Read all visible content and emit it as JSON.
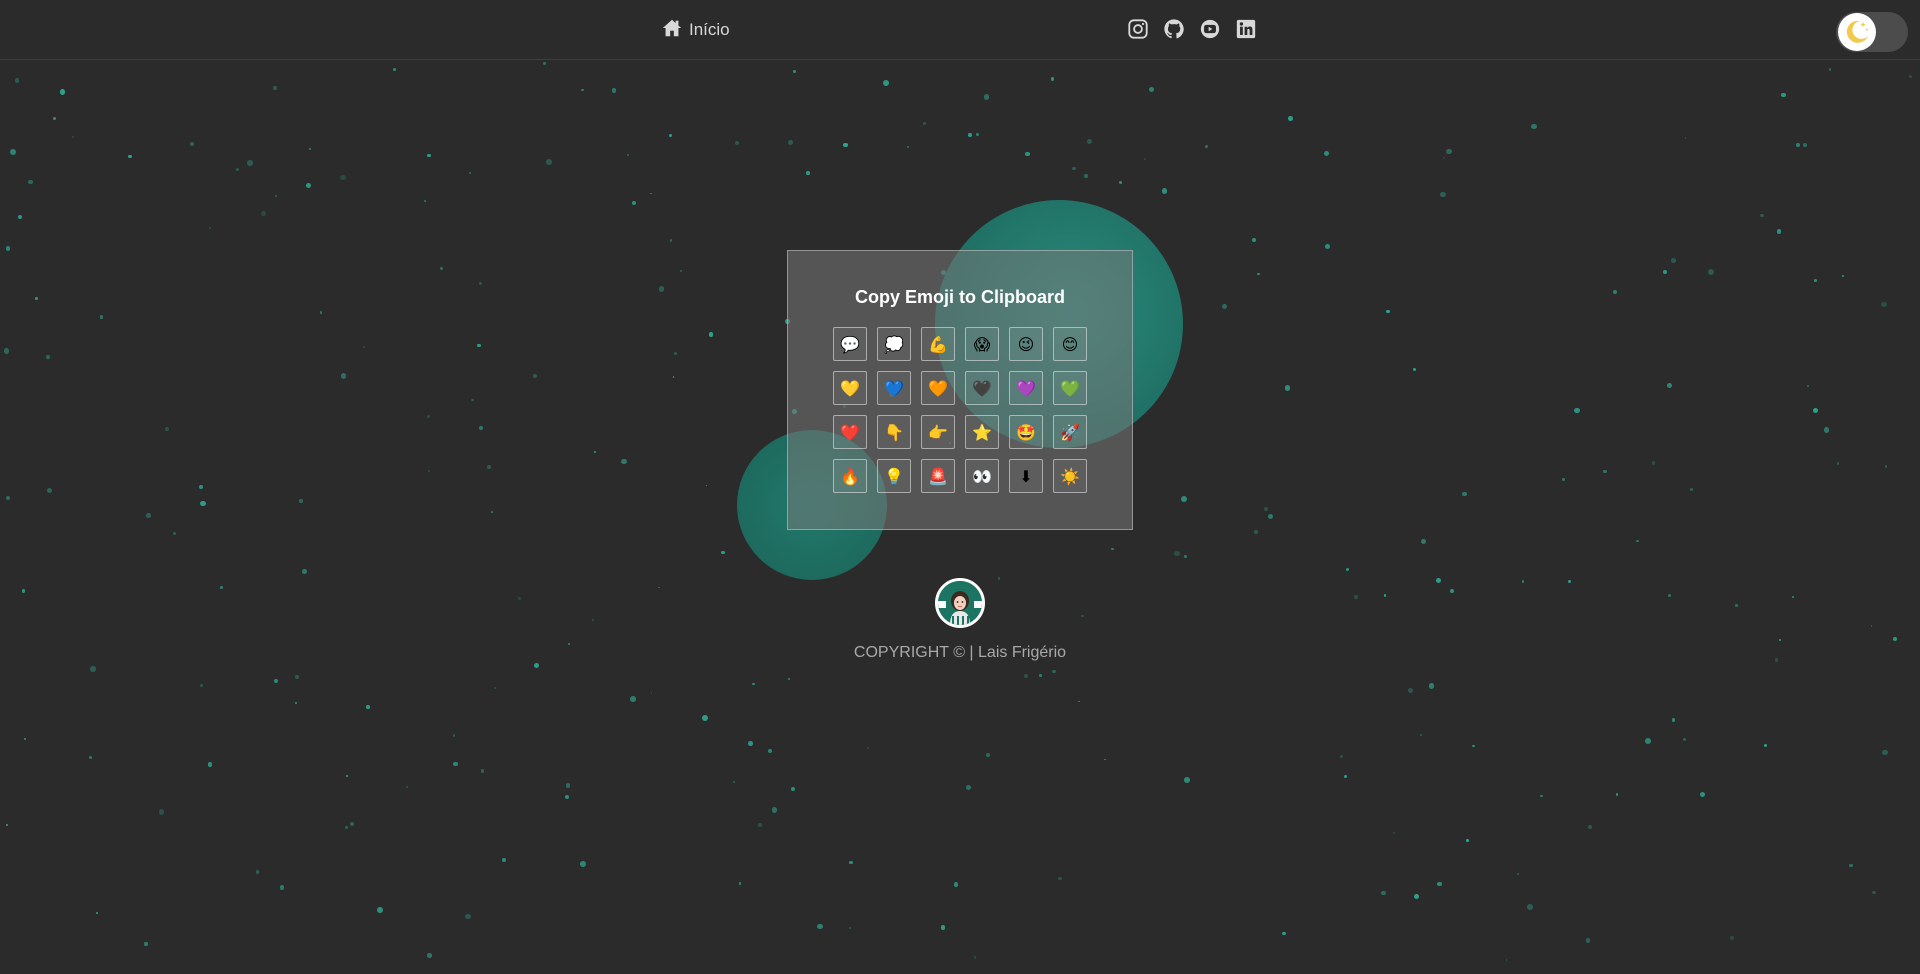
{
  "header": {
    "home_label": "Início",
    "social_links": [
      {
        "icon": "instagram-icon"
      },
      {
        "icon": "github-icon"
      },
      {
        "icon": "youtube-icon"
      },
      {
        "icon": "linkedin-icon"
      }
    ],
    "theme_toggle_icon": "moon-icon"
  },
  "card": {
    "title": "Copy Emoji to Clipboard",
    "emojis": [
      "💬",
      "💭",
      "💪",
      "😱",
      "😉",
      "😊",
      "💛",
      "💙",
      "🧡",
      "🖤",
      "💜",
      "💚",
      "❤️",
      "👇",
      "👉",
      "⭐",
      "🤩",
      "🚀",
      "🔥",
      "💡",
      "🚨",
      "👀",
      "⬇",
      "☀️"
    ]
  },
  "footer": {
    "copyright": "COPYRIGHT © | Lais Frigério"
  },
  "colors": {
    "background": "#2b2b2b",
    "accent": "#2ea58f",
    "blob": "#1f6e63"
  }
}
